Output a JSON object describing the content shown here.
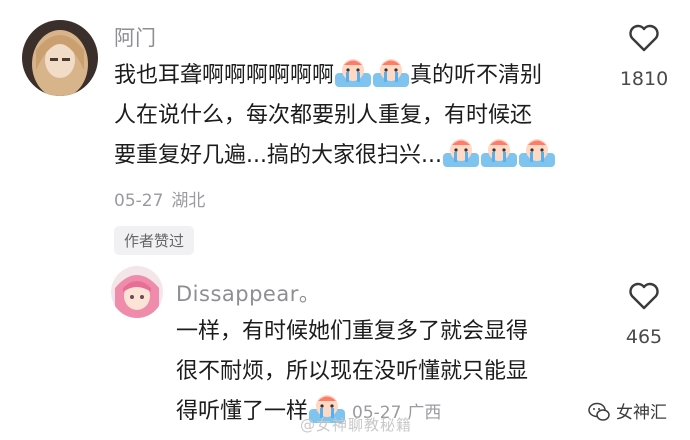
{
  "comments": [
    {
      "username": "阿门",
      "text_a": "我也耳聋啊啊啊啊啊啊",
      "text_b": "真的听不清别",
      "text_c": "人在说什么，每次都要别人重复，有时候还",
      "text_d": "要重复好几遍...搞的大家很扫兴...",
      "date": "05-27",
      "location": "湖北",
      "badge": "作者赞过",
      "like_count": "1810"
    },
    {
      "username": "Dissappear。",
      "text_a": "一样，有时候她们重复多了就会显得",
      "text_b": "很不耐烦，所以现在没听懂就只能显",
      "text_c": "得听懂了一样",
      "date": "05-27",
      "location": "广西",
      "like_count": "465"
    }
  ],
  "watermarks": {
    "center": "@女神聊教秘籍",
    "right": "女神汇"
  },
  "icons": {
    "like": "heart-outline-icon",
    "emoji": "crying-face-emoji-icon",
    "watermark": "wechat-logo-icon"
  },
  "colors": {
    "username": "#8e8e93",
    "meta": "#9b9b9f",
    "badge_bg": "#f1f1f3"
  }
}
